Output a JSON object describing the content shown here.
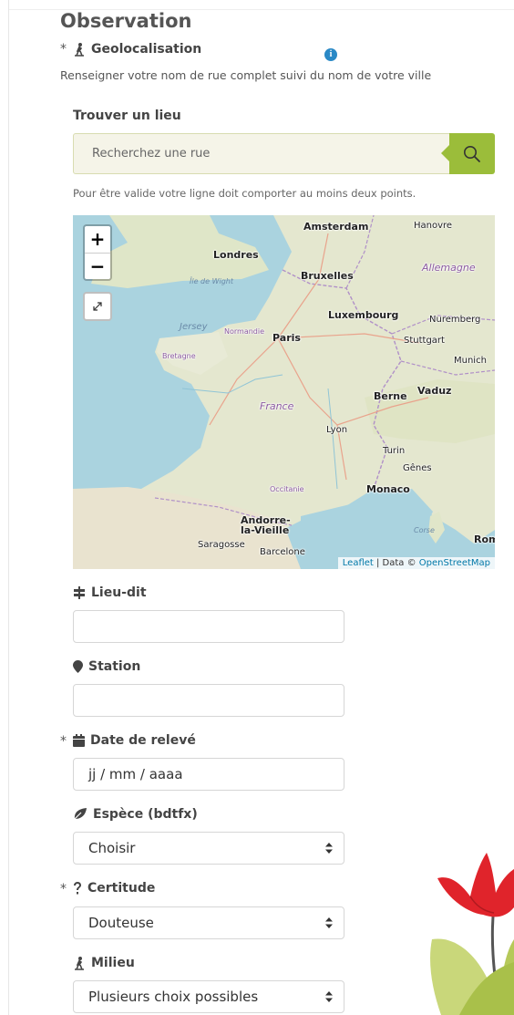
{
  "section_title": "Observation",
  "geoloc": {
    "required_mark": "*",
    "label": "Geolocalisation",
    "info_icon": "info-icon",
    "help_text": "Renseigner votre nom de rue complet suivi du nom de votre ville"
  },
  "find_place": {
    "title": "Trouver un lieu",
    "search_placeholder": "Recherchez une rue",
    "search_icon": "search-icon",
    "validity_note": "Pour être valide votre ligne doit comporter au moins deux points."
  },
  "map": {
    "zoom_in": "+",
    "zoom_out": "−",
    "attribution_leaflet": "Leaflet",
    "attribution_sep": " | Data © ",
    "attribution_osm": "OpenStreetMap",
    "places": [
      {
        "name": "Amsterdam",
        "cls": "big"
      },
      {
        "name": "Hanovre",
        "cls": "med"
      },
      {
        "name": "Londres",
        "cls": "big"
      },
      {
        "name": "Bruxelles",
        "cls": "big"
      },
      {
        "name": "Allemagne",
        "cls": "country"
      },
      {
        "name": "Luxembourg",
        "cls": "big"
      },
      {
        "name": "Nuremberg",
        "cls": "med"
      },
      {
        "name": "Paris",
        "cls": "big"
      },
      {
        "name": "Stuttgart",
        "cls": "med"
      },
      {
        "name": "Munich",
        "cls": "med"
      },
      {
        "name": "Berne",
        "cls": "big"
      },
      {
        "name": "Vaduz",
        "cls": "big"
      },
      {
        "name": "France",
        "cls": "country"
      },
      {
        "name": "Lyon",
        "cls": "med"
      },
      {
        "name": "Turin",
        "cls": "med"
      },
      {
        "name": "Gênes",
        "cls": "med"
      },
      {
        "name": "Monaco",
        "cls": "big"
      },
      {
        "name": "Andorre-la-Vieille",
        "cls": "big"
      },
      {
        "name": "Saragosse",
        "cls": "med"
      },
      {
        "name": "Barcelone",
        "cls": "med"
      },
      {
        "name": "Rom",
        "cls": "big"
      },
      {
        "name": "Jersey",
        "cls": "sea"
      },
      {
        "name": "Île de Wight",
        "cls": "sea"
      },
      {
        "name": "Bretagne",
        "cls": "small"
      },
      {
        "name": "Normandie",
        "cls": "small"
      },
      {
        "name": "Occitanie",
        "cls": "small"
      },
      {
        "name": "Corse",
        "cls": "sea"
      }
    ]
  },
  "lieu_dit": {
    "label": "Lieu-dit",
    "icon": "signpost-icon",
    "value": ""
  },
  "station": {
    "label": "Station",
    "icon": "map-marker-icon",
    "value": ""
  },
  "date": {
    "required_mark": "*",
    "label": "Date de relevé",
    "icon": "calendar-icon",
    "value": "jj / mm / aaaa"
  },
  "espece": {
    "label": "Espèce (bdtfx)",
    "icon": "leaf-icon",
    "value": "Choisir"
  },
  "certitude": {
    "required_mark": "*",
    "label": "Certitude",
    "icon": "question-icon",
    "value": "Douteuse"
  },
  "milieu": {
    "label": "Milieu",
    "icon": "hiker-icon",
    "value": "Plusieurs choix possibles"
  },
  "colors": {
    "accent": "#9bbd3a",
    "info": "#2a89c6",
    "flower_red": "#e0242b"
  }
}
